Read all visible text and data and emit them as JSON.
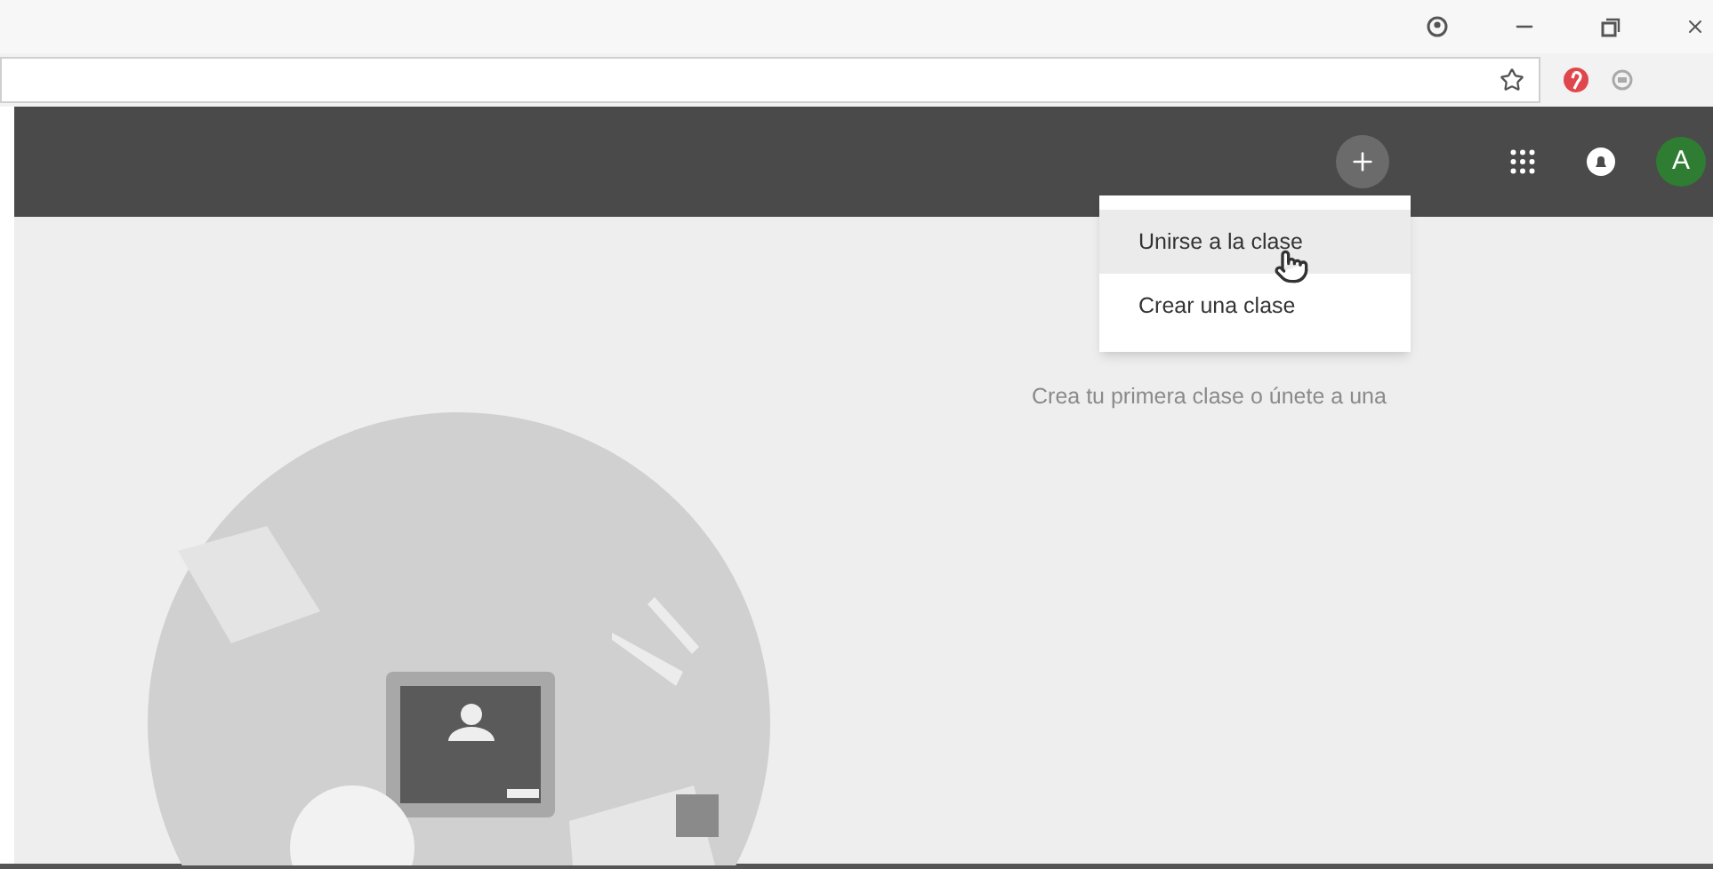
{
  "app_bar": {
    "avatar": "A"
  },
  "menu": {
    "items": [
      {
        "label": "Unirse a la clase",
        "selected": true
      },
      {
        "label": "Crear una clase",
        "selected": false
      }
    ]
  },
  "empty_state": {
    "message": "Crea tu primera clase o únete a una"
  }
}
